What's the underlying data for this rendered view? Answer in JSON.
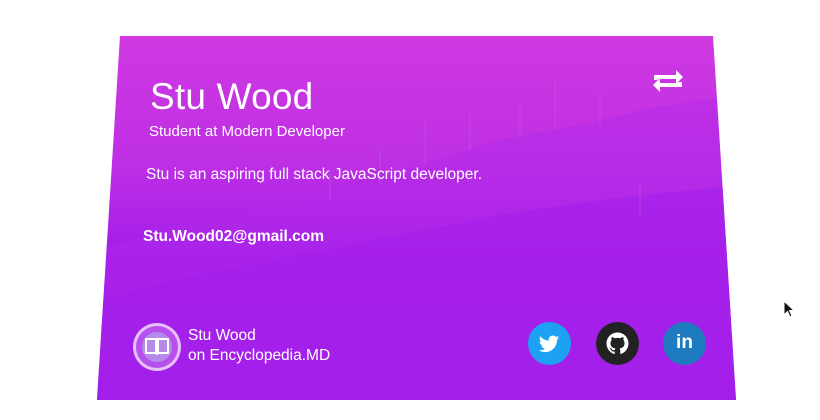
{
  "card": {
    "name": "Stu Wood",
    "role": "Student at Modern Developer",
    "bio": "Stu is an aspiring full stack JavaScript developer.",
    "email": "Stu.Wood02@gmail.com",
    "footer_name": "Stu Wood",
    "footer_site": "on Encyclopedia.MD"
  },
  "actions": {
    "flip_icon": "repeat-icon"
  },
  "social": [
    {
      "name": "twitter",
      "icon": "twitter-icon",
      "color": "#1da1f2"
    },
    {
      "name": "github",
      "icon": "github-icon",
      "color": "#222222"
    },
    {
      "name": "linkedin",
      "icon": "linkedin-icon",
      "label": "in",
      "color": "#1e7bbf"
    }
  ],
  "colors": {
    "gradient_top": "#d33ce0",
    "gradient_bottom": "#9a17ea",
    "text": "#ffffff"
  }
}
